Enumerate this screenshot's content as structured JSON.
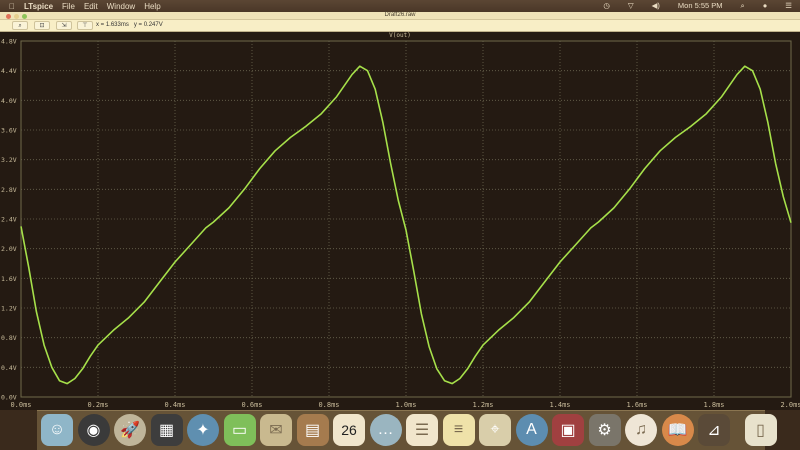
{
  "menubar": {
    "app": "LTspice",
    "items": [
      "File",
      "Edit",
      "Window",
      "Help"
    ],
    "clock": "Mon 5:55 PM"
  },
  "window": {
    "title": "Draft26.raw"
  },
  "toolbar": {
    "readout_x": "x = 1.633ms",
    "readout_y": "y = 0.247V"
  },
  "chart_data": {
    "type": "line",
    "title": "V(out)",
    "xlabel": "",
    "ylabel": "",
    "xlim": [
      0,
      2.0
    ],
    "ylim": [
      0,
      4.8
    ],
    "x_ticks": [
      "0.0ms",
      "0.2ms",
      "0.4ms",
      "0.6ms",
      "0.8ms",
      "1.0ms",
      "1.2ms",
      "1.4ms",
      "1.6ms",
      "1.8ms",
      "2.0ms"
    ],
    "y_ticks": [
      "0.0V",
      "0.4V",
      "0.8V",
      "1.2V",
      "1.6V",
      "2.0V",
      "2.4V",
      "2.8V",
      "3.2V",
      "3.6V",
      "4.0V",
      "4.4V",
      "4.8V"
    ],
    "grid": true,
    "line_color": "#a6e04a",
    "series": [
      {
        "name": "V(out)",
        "x": [
          0,
          0.02,
          0.04,
          0.06,
          0.08,
          0.1,
          0.12,
          0.14,
          0.16,
          0.18,
          0.2,
          0.24,
          0.28,
          0.32,
          0.36,
          0.4,
          0.44,
          0.48,
          0.5,
          0.54,
          0.58,
          0.62,
          0.66,
          0.7,
          0.74,
          0.78,
          0.82,
          0.86,
          0.88,
          0.9,
          0.92,
          0.94,
          0.96,
          0.98,
          1.0,
          1.02,
          1.04,
          1.06,
          1.08,
          1.1,
          1.12,
          1.14,
          1.16,
          1.18,
          1.2,
          1.24,
          1.28,
          1.32,
          1.36,
          1.4,
          1.44,
          1.48,
          1.5,
          1.54,
          1.58,
          1.62,
          1.66,
          1.7,
          1.74,
          1.78,
          1.82,
          1.86,
          1.88,
          1.9,
          1.92,
          1.94,
          1.96,
          1.98,
          2.0
        ],
        "y": [
          2.3,
          1.75,
          1.15,
          0.7,
          0.4,
          0.22,
          0.18,
          0.25,
          0.38,
          0.55,
          0.7,
          0.9,
          1.07,
          1.28,
          1.55,
          1.82,
          2.05,
          2.28,
          2.36,
          2.55,
          2.8,
          3.08,
          3.32,
          3.5,
          3.65,
          3.82,
          4.05,
          4.35,
          4.46,
          4.4,
          4.15,
          3.7,
          3.15,
          2.65,
          2.25,
          1.7,
          1.12,
          0.68,
          0.38,
          0.22,
          0.18,
          0.25,
          0.38,
          0.55,
          0.7,
          0.9,
          1.07,
          1.28,
          1.55,
          1.82,
          2.05,
          2.28,
          2.36,
          2.55,
          2.8,
          3.08,
          3.32,
          3.5,
          3.65,
          3.82,
          4.05,
          4.35,
          4.46,
          4.4,
          4.15,
          3.7,
          3.15,
          2.7,
          2.35
        ]
      }
    ]
  },
  "dock": [
    "finder",
    "dashboard",
    "launchpad",
    "mission-control",
    "safari",
    "facetime",
    "mail",
    "contacts",
    "calendar",
    "messages",
    "reminders",
    "notes",
    "maps",
    "app-store",
    "photo-booth",
    "system-preferences",
    "itunes",
    "ibooks",
    "ltspice",
    "trash"
  ],
  "calendar_day": "26"
}
